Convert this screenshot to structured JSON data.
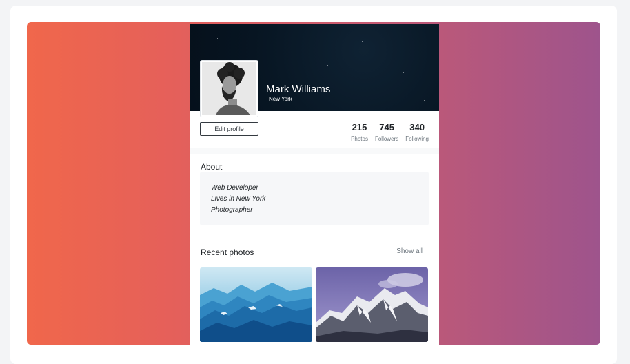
{
  "profile": {
    "name": "Mark Williams",
    "location": "New York",
    "edit_label": "Edit profile",
    "stats": [
      {
        "value": "215",
        "label": "Photos"
      },
      {
        "value": "745",
        "label": "Followers"
      },
      {
        "value": "340",
        "label": "Following"
      }
    ]
  },
  "about": {
    "title": "About",
    "lines": [
      "Web Developer",
      "Lives in New York",
      "Photographer"
    ]
  },
  "photos": {
    "title": "Recent photos",
    "show_all_label": "Show all"
  },
  "colors": {
    "gradient_start": "#f0674b",
    "gradient_end": "#9e548c",
    "cover_dark": "#071522"
  }
}
